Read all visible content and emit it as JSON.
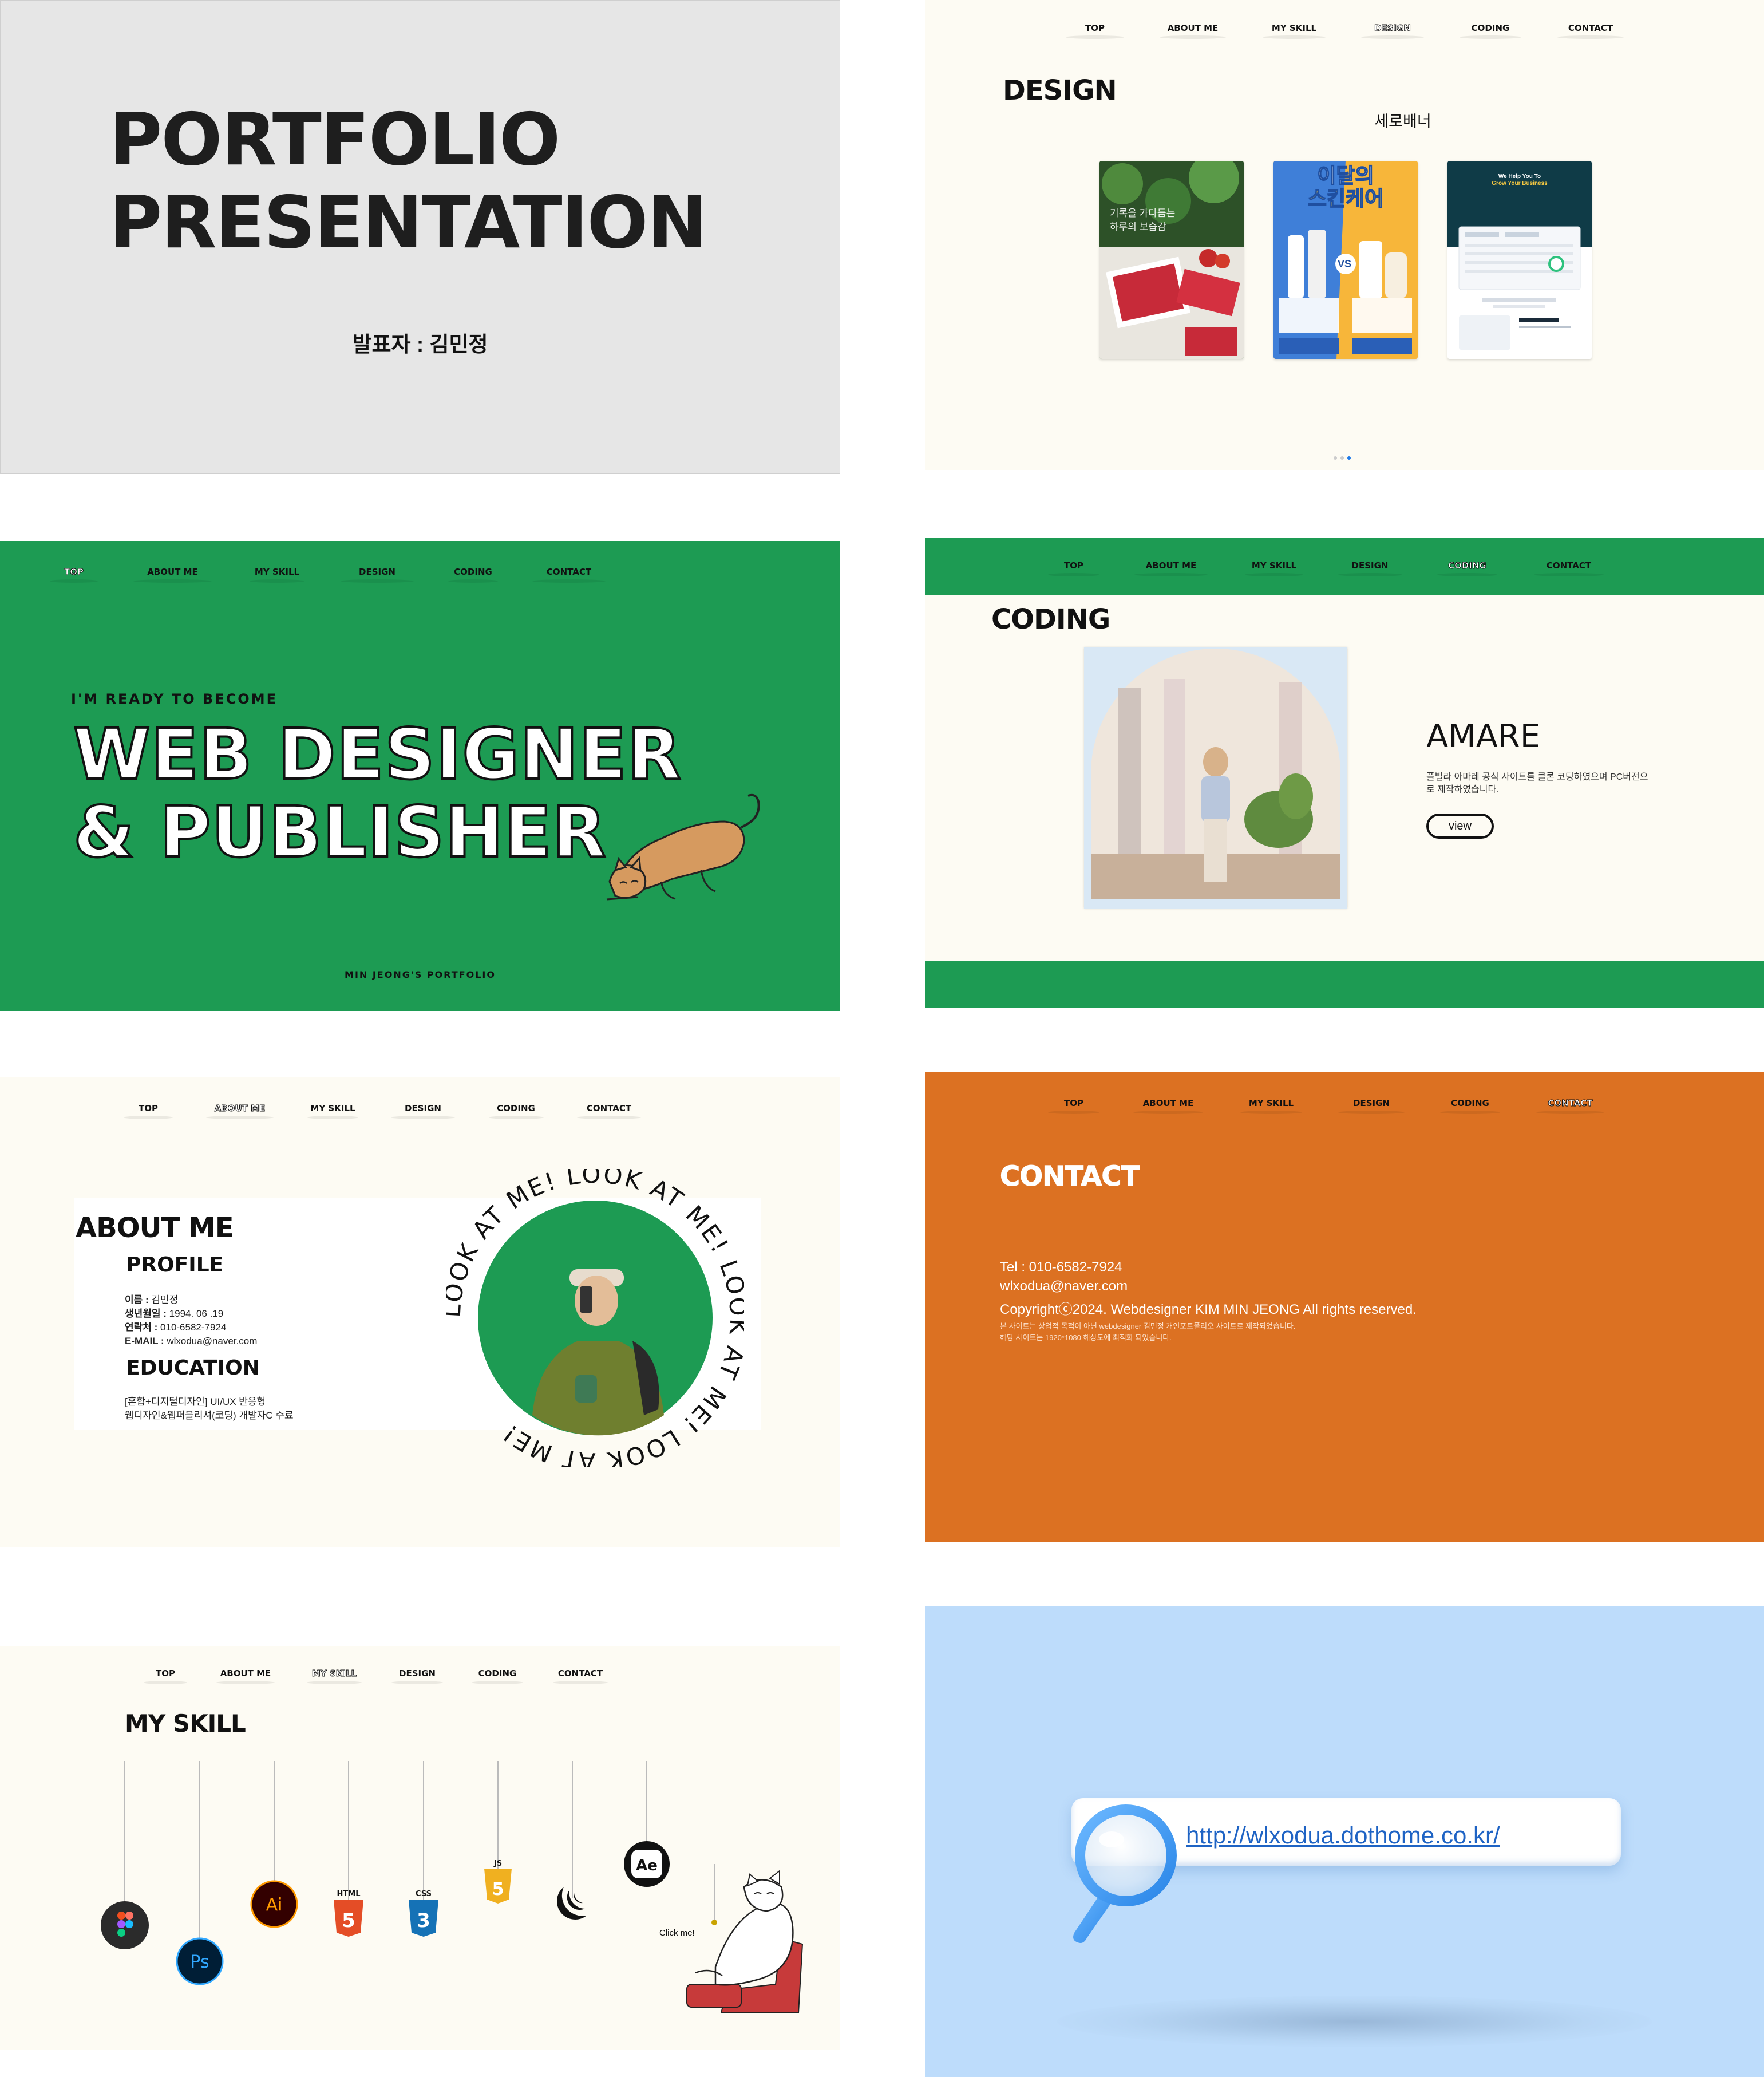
{
  "nav": [
    "TOP",
    "ABOUT ME",
    "MY SKILL",
    "DESIGN",
    "CODING",
    "CONTACT"
  ],
  "cover": {
    "title_line1": "PORTFOLIO",
    "title_line2": "PRESENTATION",
    "presenter": "발표자 : 김민정"
  },
  "design": {
    "title": "DESIGN",
    "subtitle": "세로배너",
    "thumbs": [
      {
        "title_lines": [
          "기록을 가다듬는",
          "하루의 보습감"
        ]
      },
      {
        "title_lines": [
          "이달의",
          "스킨케어"
        ],
        "badge": "VS"
      },
      {
        "title_lines": [
          "We Help You To",
          "Grow Your Business"
        ]
      }
    ],
    "active_dot": 3
  },
  "hero": {
    "kicker": "I'M READY TO BECOME",
    "line1": "WEB DESIGNER",
    "line2": "& PUBLISHER",
    "footer": "MIN JEONG'S PORTFOLIO"
  },
  "coding": {
    "title": "CODING",
    "project": "AMARE",
    "desc": "플빌라 아마레 공식 사이트를 클론 코딩하였으며 PC버전으로 제작하였습니다.",
    "view": "view"
  },
  "about": {
    "title": "ABOUT ME",
    "profile_h": "PROFILE",
    "name_k": "이름 :",
    "name_v": " 김민정",
    "birth_k": "생년월일 :",
    "birth_v": " 1994. 06 .19",
    "phone_k": "연락처 :",
    "phone_v": " 010-6582-7924",
    "email_k": "E-MAIL :",
    "email_v": " wlxodua@naver.com",
    "education_h": "EDUCATION",
    "edu_line1": "[혼합+디지털디자인] UI/UX 반응형",
    "edu_line2": "웹디자인&웹퍼블리셔(코딩) 개발자C 수료",
    "circle_text": "LOOK AT ME! LOOK AT ME! LOOK AT ME! LOOK AT ME! "
  },
  "contact": {
    "title": "CONTACT",
    "tel": "Tel : 010-6582-7924",
    "email": "wlxodua@naver.com",
    "copyright": "Copyrightⓒ2024. Webdesigner KIM MIN JEONG All rights reserved.",
    "note1": "본 사이트는 상업적 목적이 아닌 webdesigner 김민정 개인포트폴리오 사이트로 제작되었습니다.",
    "note2": "해당 사이트는 1920*1080 해상도에 최적화 되었습니다."
  },
  "skill": {
    "title": "MY SKILL",
    "icons": [
      "figma",
      "Ps",
      "Ai",
      "HTML",
      "CSS",
      "JS",
      "jquery",
      "Ae"
    ],
    "html_label": "HTML",
    "css_label": "CSS",
    "js_label": "JS",
    "click_me": "Click me!"
  },
  "link": {
    "url": "http://wlxodua.dothome.co.kr/"
  },
  "colors": {
    "green": "#1d9b53",
    "orange": "#dc7122",
    "cream": "#fdfbf3",
    "sky": "#bddcfb"
  }
}
